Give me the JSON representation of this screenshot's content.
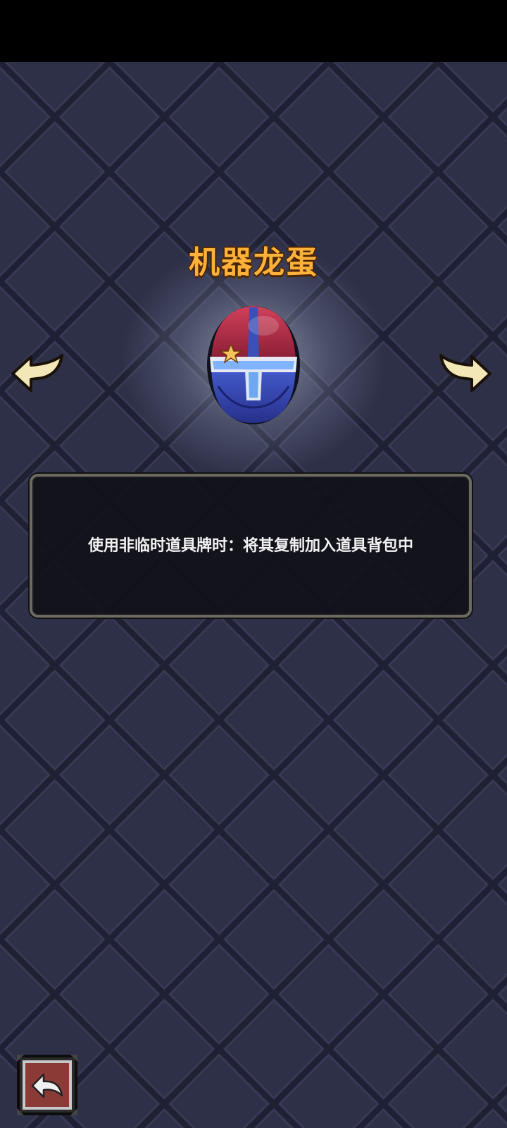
{
  "item": {
    "title": "机器龙蛋",
    "description": "使用非临时道具牌时：将其复制加入道具背包中",
    "icon": "robot-dragon-egg"
  },
  "navigation": {
    "prev_icon": "arrow-left-icon",
    "next_icon": "arrow-right-icon",
    "back_icon": "return-arrow-icon"
  },
  "colors": {
    "background": "#2c2d44",
    "title": "#ffb23a",
    "arrow": "#f3e7b8",
    "back_button": "#8a3b36"
  }
}
